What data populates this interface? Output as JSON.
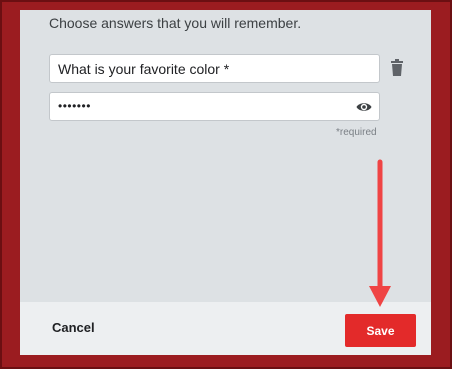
{
  "dialog": {
    "instructions": "Choose answers that you will remember.",
    "question_field": {
      "value": "What is your favorite color *"
    },
    "answer_field": {
      "masked_value": "•••••••",
      "toggle_icon": "eye-icon"
    },
    "delete_icon": "trash-icon",
    "required_note": "*required"
  },
  "footer": {
    "cancel_label": "Cancel",
    "save_label": "Save"
  },
  "colors": {
    "frame": "#9b1c20",
    "dialog_background": "#dde1e4",
    "save_button": "#e32a2a",
    "annotation_arrow": "#ef4444"
  }
}
